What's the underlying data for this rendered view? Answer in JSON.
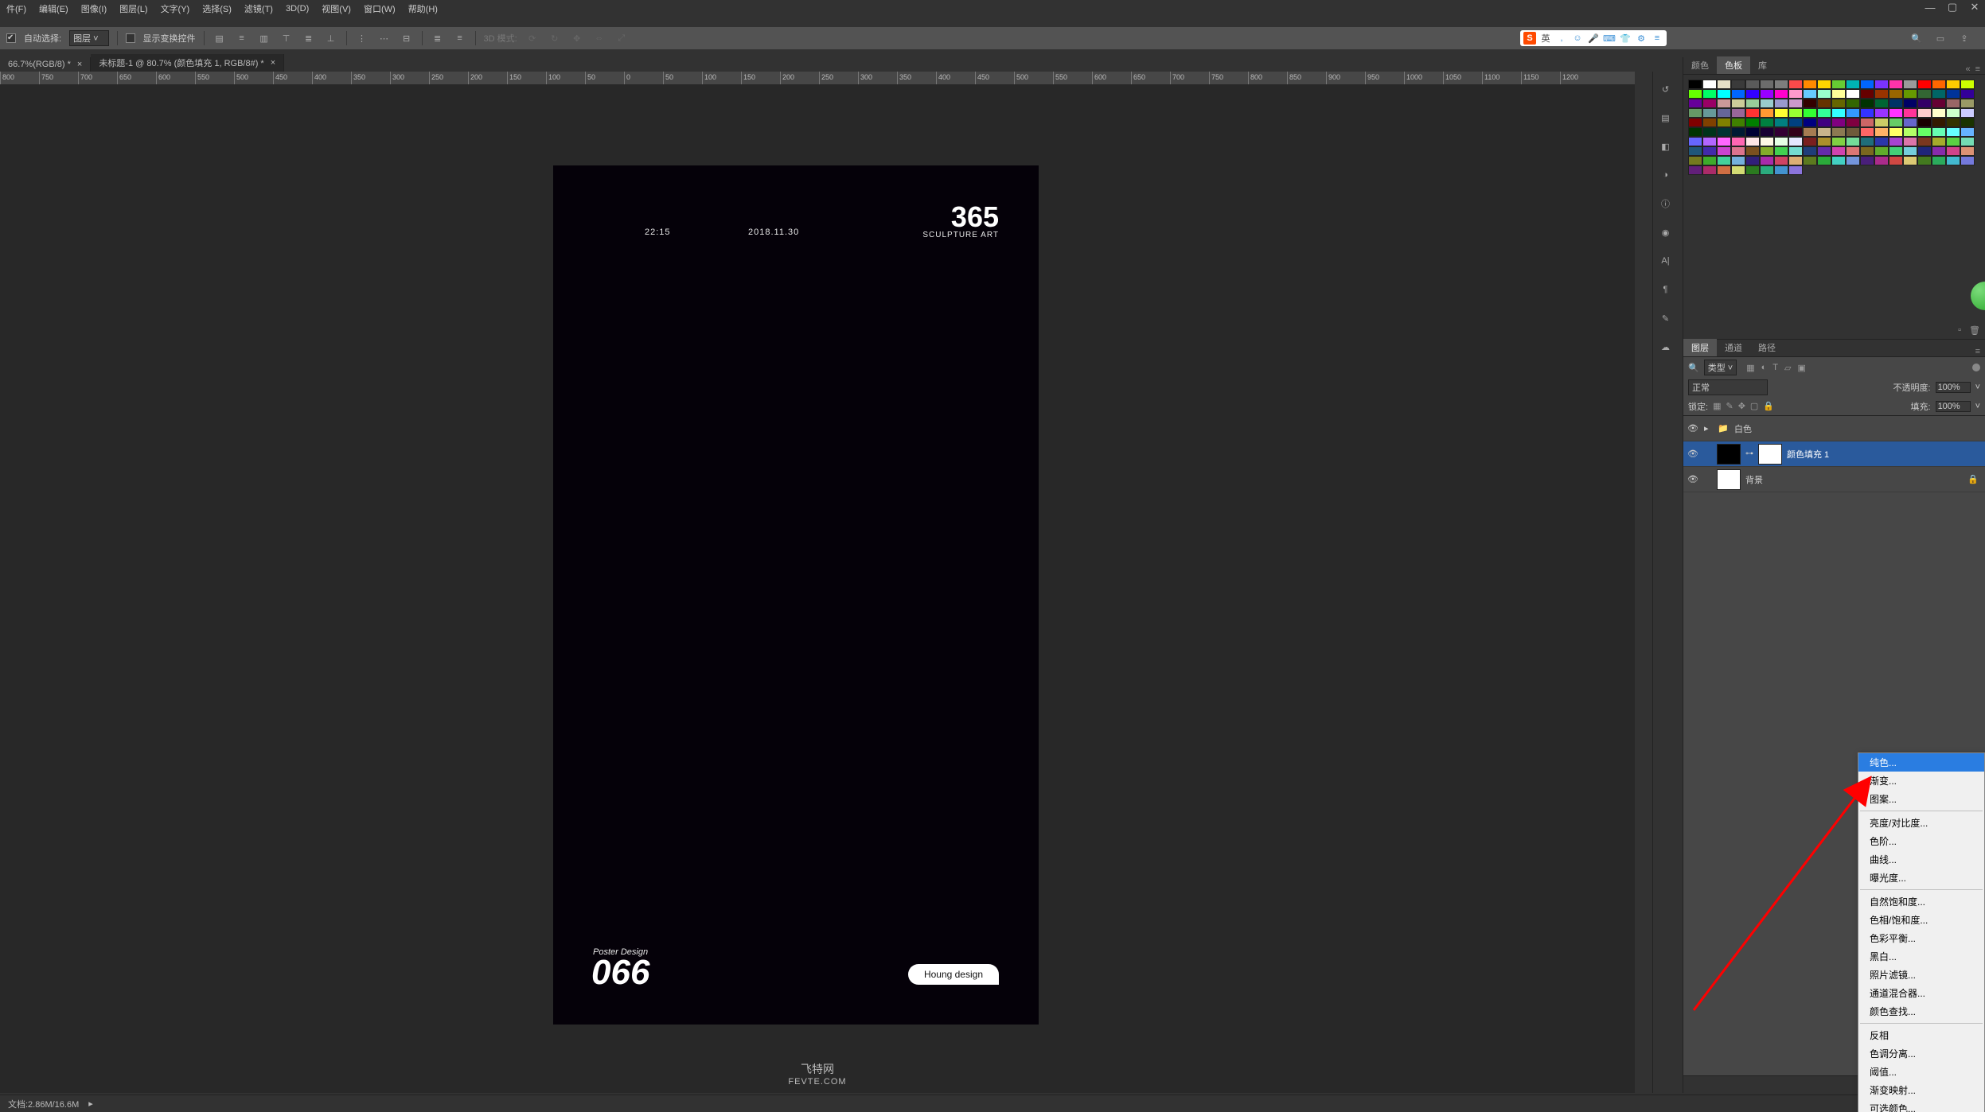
{
  "menu": {
    "items": [
      "件(F)",
      "编辑(E)",
      "图像(I)",
      "图层(L)",
      "文字(Y)",
      "选择(S)",
      "滤镜(T)",
      "3D(D)",
      "视图(V)",
      "窗口(W)",
      "帮助(H)"
    ]
  },
  "options": {
    "auto_select": "自动选择:",
    "layer_select": "图层",
    "show_transform": "显示变换控件",
    "mode_3d": "3D 模式:"
  },
  "ime": {
    "lang": "英",
    "logo": "S"
  },
  "tabs": [
    {
      "label": "66.7%(RGB/8) *"
    },
    {
      "label": "未标题-1 @ 80.7% (颜色填充 1, RGB/8#) *"
    }
  ],
  "ruler_values": [
    "800",
    "750",
    "700",
    "650",
    "600",
    "550",
    "500",
    "450",
    "400",
    "350",
    "300",
    "250",
    "200",
    "150",
    "100",
    "50",
    "0",
    "50",
    "100",
    "150",
    "200",
    "250",
    "300",
    "350",
    "400",
    "450",
    "500",
    "550",
    "600",
    "650",
    "700",
    "750",
    "800",
    "850",
    "900",
    "950",
    "1000",
    "1050",
    "1100",
    "1150",
    "1200"
  ],
  "artboard": {
    "time": "22:15",
    "date": "2018.11.30",
    "bignum": "365",
    "subtitle": "SCULPTURE ART",
    "poster_design": "Poster Design",
    "bignum2": "066",
    "pill": "Houng design"
  },
  "watermark": {
    "l1": "飞特网",
    "l2": "FEVTE.COM"
  },
  "swatch_tabs": [
    "颜色",
    "色板",
    "库"
  ],
  "swatch_colors": [
    "#000000",
    "#ffffff",
    "#e6e0c8",
    "#3a3a3a",
    "#5a5a5a",
    "#6c6c6c",
    "#7d7d7d",
    "#f94a4a",
    "#ff8a00",
    "#ffd400",
    "#66cc33",
    "#00b3b3",
    "#0066ff",
    "#7a33ff",
    "#ff33aa",
    "#9a9a9a",
    "#ff0000",
    "#ff6600",
    "#ffcc00",
    "#ccff00",
    "#66ff00",
    "#00ff66",
    "#00ffff",
    "#0066ff",
    "#3300ff",
    "#9900ff",
    "#ff00cc",
    "#ff99cc",
    "#66ccff",
    "#99ffcc",
    "#ffff99",
    "#ffffff",
    "#660000",
    "#993300",
    "#996600",
    "#669900",
    "#336633",
    "#006666",
    "#003399",
    "#330099",
    "#660099",
    "#990066",
    "#cc9999",
    "#cccc99",
    "#99cc99",
    "#99cccc",
    "#9999cc",
    "#cc99cc",
    "#330000",
    "#663300",
    "#666600",
    "#336600",
    "#003300",
    "#006633",
    "#003366",
    "#000066",
    "#330066",
    "#660033",
    "#996666",
    "#999966",
    "#669966",
    "#669999",
    "#666699",
    "#996699",
    "#ff3333",
    "#ff9933",
    "#ffff33",
    "#99ff33",
    "#33ff33",
    "#33ff99",
    "#33ffff",
    "#3399ff",
    "#3333ff",
    "#9933ff",
    "#ff33ff",
    "#ff3399",
    "#ffcccc",
    "#ffffcc",
    "#ccffcc",
    "#ccccff",
    "#800000",
    "#804000",
    "#808000",
    "#408000",
    "#008000",
    "#008040",
    "#008080",
    "#004080",
    "#000080",
    "#400080",
    "#800080",
    "#800040",
    "#cc6666",
    "#cccc66",
    "#66cc66",
    "#6666cc",
    "#1a0000",
    "#331a00",
    "#333300",
    "#1a3300",
    "#003300",
    "#00331a",
    "#003333",
    "#001a33",
    "#000033",
    "#1a0033",
    "#330033",
    "#33001a",
    "#a67c52",
    "#c8b48c",
    "#8c7a52",
    "#6e5a3a",
    "#ff6666",
    "#ffb366",
    "#ffff66",
    "#b3ff66",
    "#66ff66",
    "#66ffb3",
    "#66ffff",
    "#66b3ff",
    "#6666ff",
    "#b366ff",
    "#ff66ff",
    "#ff66b3",
    "#ffe6e6",
    "#fff7e6",
    "#e6ffe6",
    "#e6e6ff"
  ],
  "layers_tabs": [
    "图层",
    "通道",
    "路径"
  ],
  "layers": {
    "filter_label": "类型",
    "blend_mode": "正常",
    "opacity_label": "不透明度:",
    "opacity_value": "100%",
    "lock_label": "锁定:",
    "fill_label": "填充:",
    "fill_value": "100%",
    "rows": [
      {
        "type": "folder",
        "name": "白色"
      },
      {
        "type": "fill",
        "name": "颜色填充 1",
        "selected": true
      },
      {
        "type": "bg",
        "name": "背景",
        "locked": true
      }
    ]
  },
  "ctx_menu": {
    "items": [
      {
        "t": "纯色...",
        "hl": true
      },
      {
        "t": "渐变..."
      },
      {
        "t": "图案..."
      },
      {
        "sep": true
      },
      {
        "t": "亮度/对比度..."
      },
      {
        "t": "色阶..."
      },
      {
        "t": "曲线..."
      },
      {
        "t": "曝光度..."
      },
      {
        "sep": true
      },
      {
        "t": "自然饱和度..."
      },
      {
        "t": "色相/饱和度..."
      },
      {
        "t": "色彩平衡..."
      },
      {
        "t": "黑白..."
      },
      {
        "t": "照片滤镜..."
      },
      {
        "t": "通道混合器..."
      },
      {
        "t": "颜色查找..."
      },
      {
        "sep": true
      },
      {
        "t": "反相"
      },
      {
        "t": "色调分离..."
      },
      {
        "t": "阈值..."
      },
      {
        "t": "渐变映射..."
      },
      {
        "t": "可选颜色..."
      }
    ]
  },
  "statusbar": {
    "doc_info": "文档:2.86M/16.6M"
  }
}
